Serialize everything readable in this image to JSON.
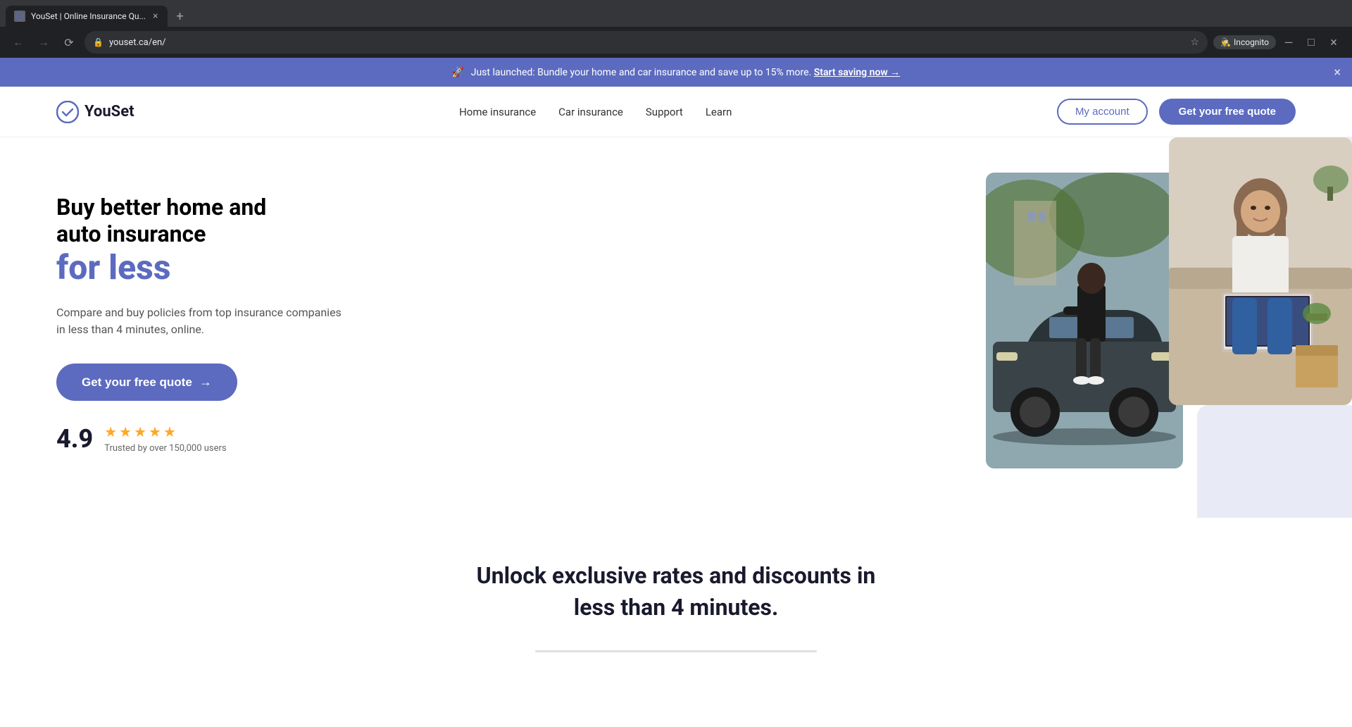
{
  "browser": {
    "tab": {
      "favicon_alt": "YouSet favicon",
      "title": "YouSet | Online Insurance Qu...",
      "close_label": "×",
      "new_tab_label": "+"
    },
    "nav": {
      "back_disabled": false,
      "forward_disabled": true,
      "refresh_label": "↻",
      "address": "youset.ca/en/",
      "incognito_label": "Incognito"
    },
    "window_controls": {
      "minimize": "—",
      "maximize": "□",
      "close": "×"
    }
  },
  "banner": {
    "rocket_emoji": "🚀",
    "text": "Just launched: Bundle your home and car insurance and save up to 15% more.",
    "link_text": "Start saving now →",
    "close_label": "×"
  },
  "nav": {
    "logo_text": "YouSet",
    "links": [
      {
        "id": "home-insurance",
        "label": "Home insurance"
      },
      {
        "id": "car-insurance",
        "label": "Car insurance"
      },
      {
        "id": "support",
        "label": "Support"
      },
      {
        "id": "learn",
        "label": "Learn"
      }
    ],
    "my_account_label": "My account",
    "cta_label": "Get your free quote"
  },
  "hero": {
    "title_line1": "Buy better home and",
    "title_line2": "auto insurance",
    "title_accent": "for less",
    "subtitle": "Compare and buy policies from top insurance companies in less than 4 minutes, online.",
    "cta_label": "Get your free quote",
    "cta_arrow": "→",
    "rating": {
      "number": "4.9",
      "stars": [
        "★",
        "★",
        "★",
        "★",
        "★"
      ],
      "trust_text": "Trusted by over 150,000 users"
    }
  },
  "section": {
    "title": "Unlock exclusive rates and discounts in less than 4 minutes."
  }
}
